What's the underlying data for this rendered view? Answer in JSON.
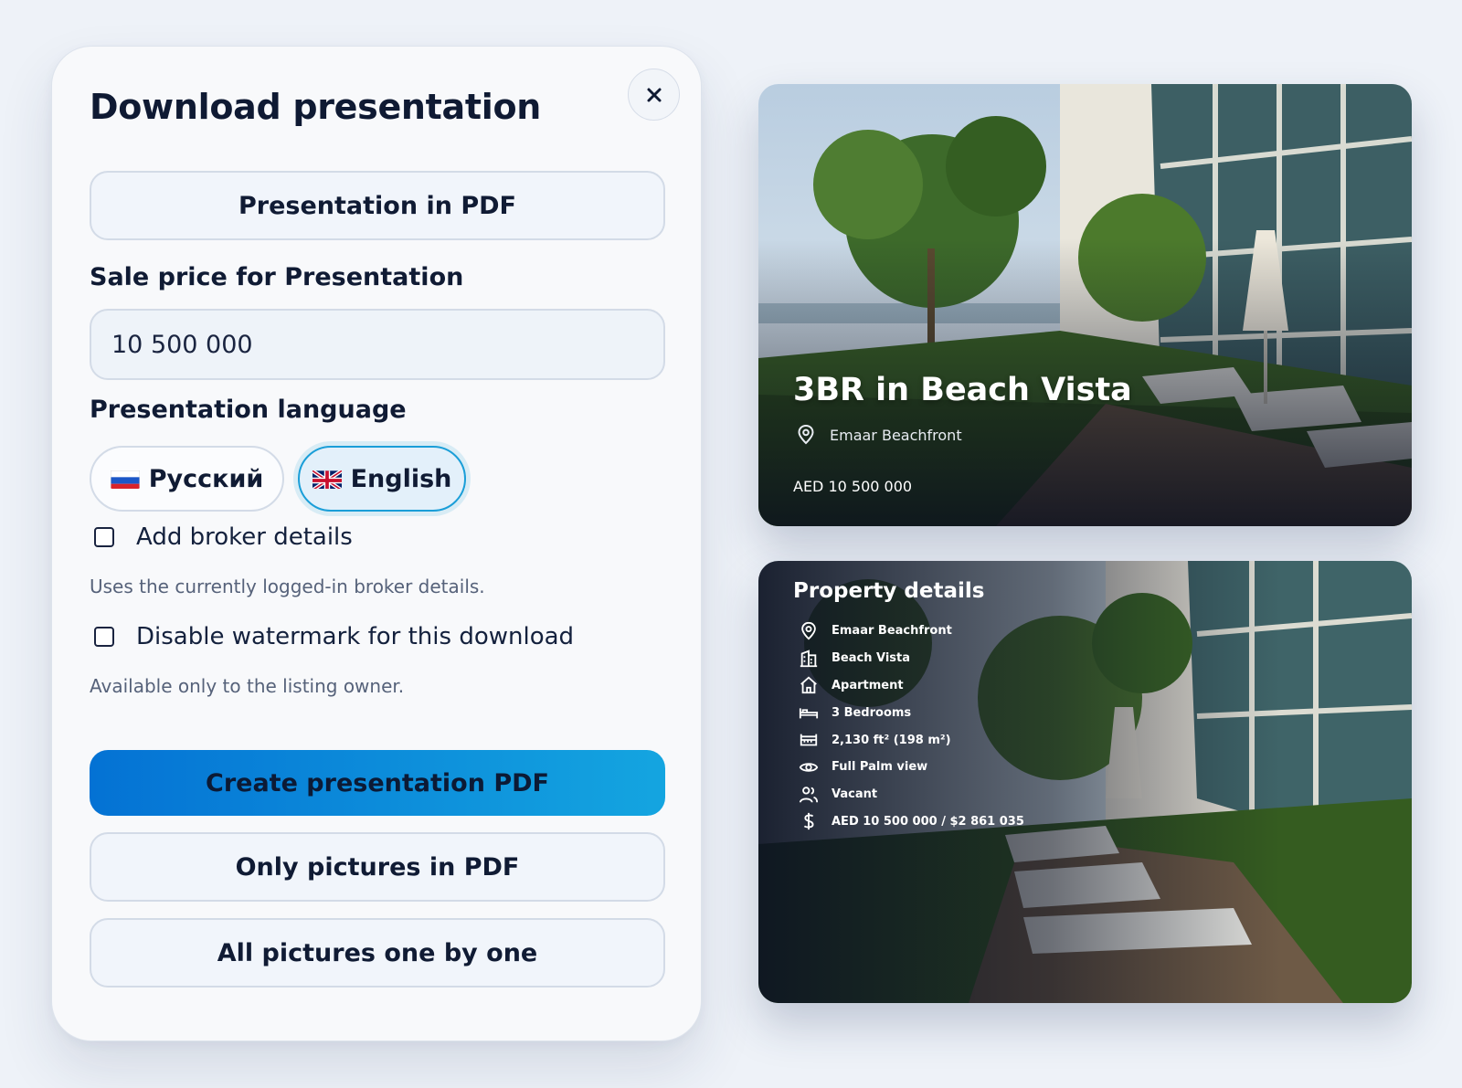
{
  "dialog": {
    "title": "Download presentation",
    "close_label": "×",
    "pdf_button": "Presentation in PDF",
    "sale_price_label": "Sale price for Presentation",
    "sale_price_value": "10 500 000",
    "language_label": "Presentation language",
    "languages": [
      {
        "label": "Русский",
        "flag": "ru-flag-icon",
        "selected": false
      },
      {
        "label": "English",
        "flag": "uk-flag-icon",
        "selected": true
      }
    ],
    "broker_checkbox_label": "Add broker details",
    "broker_hint": "Uses the currently logged-in broker details.",
    "watermark_checkbox_label": "Disable watermark for this download",
    "watermark_hint": "Available only to the listing owner.",
    "create_button": "Create presentation PDF",
    "only_pictures_button": "Only pictures in PDF",
    "all_pictures_button": "All pictures one by one",
    "accent_color": "#0a8bd9"
  },
  "cover_card": {
    "title": "3BR in Beach Vista",
    "location": "Emaar Beachfront",
    "location_icon": "location-pin-icon",
    "price": "AED 10 500 000"
  },
  "details_card": {
    "title": "Property details",
    "items": [
      {
        "icon": "location-pin-icon",
        "text": "Emaar Beachfront"
      },
      {
        "icon": "building-icon",
        "text": "Beach Vista"
      },
      {
        "icon": "home-icon",
        "text": "Apartment"
      },
      {
        "icon": "bed-icon",
        "text": "3 Bedrooms"
      },
      {
        "icon": "ruler-icon",
        "text": "2,130 ft² (198 m²)"
      },
      {
        "icon": "eye-icon",
        "text": "Full Palm view"
      },
      {
        "icon": "users-icon",
        "text": "Vacant"
      },
      {
        "icon": "dollar-icon",
        "text": "AED 10 500 000 / $2 861 035"
      }
    ]
  }
}
